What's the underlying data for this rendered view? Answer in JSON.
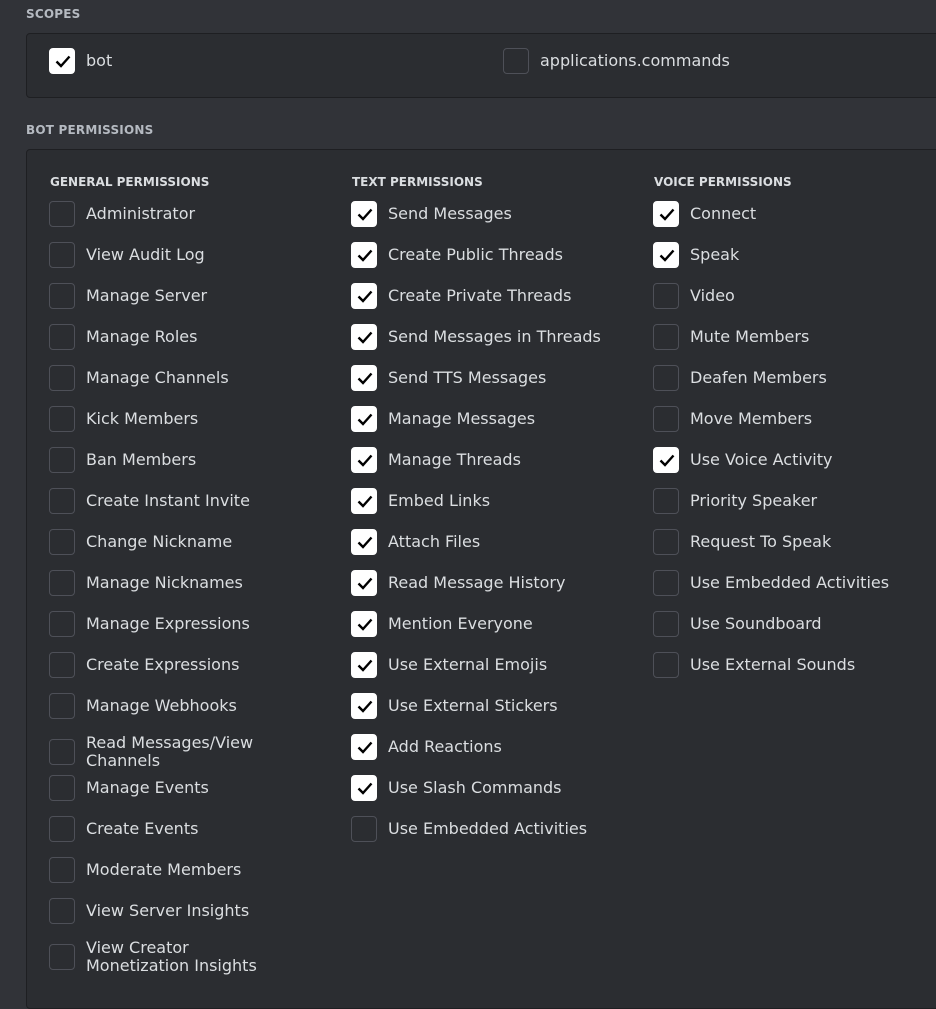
{
  "scopes": {
    "title": "SCOPES",
    "items": [
      {
        "label": "bot",
        "checked": true
      },
      {
        "label": "applications.commands",
        "checked": false
      }
    ]
  },
  "bot_permissions": {
    "title": "BOT PERMISSIONS",
    "columns": [
      {
        "heading": "GENERAL PERMISSIONS",
        "items": [
          {
            "label": "Administrator",
            "checked": false
          },
          {
            "label": "View Audit Log",
            "checked": false
          },
          {
            "label": "Manage Server",
            "checked": false
          },
          {
            "label": "Manage Roles",
            "checked": false
          },
          {
            "label": "Manage Channels",
            "checked": false
          },
          {
            "label": "Kick Members",
            "checked": false
          },
          {
            "label": "Ban Members",
            "checked": false
          },
          {
            "label": "Create Instant Invite",
            "checked": false
          },
          {
            "label": "Change Nickname",
            "checked": false
          },
          {
            "label": "Manage Nicknames",
            "checked": false
          },
          {
            "label": "Manage Expressions",
            "checked": false
          },
          {
            "label": "Create Expressions",
            "checked": false
          },
          {
            "label": "Manage Webhooks",
            "checked": false
          },
          {
            "label": "Read Messages/View Channels",
            "checked": false
          },
          {
            "label": "Manage Events",
            "checked": false
          },
          {
            "label": "Create Events",
            "checked": false
          },
          {
            "label": "Moderate Members",
            "checked": false
          },
          {
            "label": "View Server Insights",
            "checked": false
          },
          {
            "label": "View Creator Monetization Insights",
            "checked": false
          }
        ]
      },
      {
        "heading": "TEXT PERMISSIONS",
        "items": [
          {
            "label": "Send Messages",
            "checked": true
          },
          {
            "label": "Create Public Threads",
            "checked": true
          },
          {
            "label": "Create Private Threads",
            "checked": true
          },
          {
            "label": "Send Messages in Threads",
            "checked": true
          },
          {
            "label": "Send TTS Messages",
            "checked": true
          },
          {
            "label": "Manage Messages",
            "checked": true
          },
          {
            "label": "Manage Threads",
            "checked": true
          },
          {
            "label": "Embed Links",
            "checked": true
          },
          {
            "label": "Attach Files",
            "checked": true
          },
          {
            "label": "Read Message History",
            "checked": true
          },
          {
            "label": "Mention Everyone",
            "checked": true
          },
          {
            "label": "Use External Emojis",
            "checked": true
          },
          {
            "label": "Use External Stickers",
            "checked": true
          },
          {
            "label": "Add Reactions",
            "checked": true
          },
          {
            "label": "Use Slash Commands",
            "checked": true
          },
          {
            "label": "Use Embedded Activities",
            "checked": false
          }
        ]
      },
      {
        "heading": "VOICE PERMISSIONS",
        "items": [
          {
            "label": "Connect",
            "checked": true
          },
          {
            "label": "Speak",
            "checked": true
          },
          {
            "label": "Video",
            "checked": false
          },
          {
            "label": "Mute Members",
            "checked": false
          },
          {
            "label": "Deafen Members",
            "checked": false
          },
          {
            "label": "Move Members",
            "checked": false
          },
          {
            "label": "Use Voice Activity",
            "checked": true
          },
          {
            "label": "Priority Speaker",
            "checked": false
          },
          {
            "label": "Request To Speak",
            "checked": false
          },
          {
            "label": "Use Embedded Activities",
            "checked": false
          },
          {
            "label": "Use Soundboard",
            "checked": false
          },
          {
            "label": "Use External Sounds",
            "checked": false
          }
        ]
      }
    ]
  },
  "icons": {
    "check": "checkmark-icon"
  }
}
